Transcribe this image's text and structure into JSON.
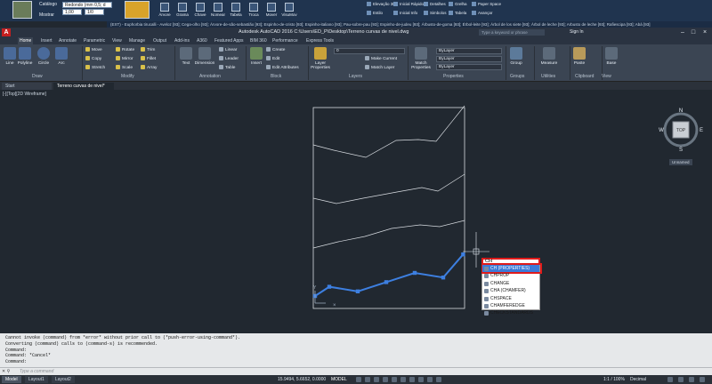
{
  "plugin_bar": {
    "catalog_label": "Catálogo",
    "tree_label": "Mostrar",
    "dropdown1": "Redondo (mm 0,5; d",
    "dropdown2": "1,00",
    "dropdown3": "1/0",
    "buttons": [
      "Árvore",
      "Grama",
      "Chave",
      "Nomear",
      "Tabela",
      "Troca",
      "Mover",
      "VisuMov"
    ],
    "small_col1": [
      "Elevação 3D",
      "Estilo",
      "Estilo"
    ],
    "small_col2": [
      "Inicial Rápido",
      "Inicial Info",
      "Inicial Info"
    ],
    "small_col3": [
      "Detalhes",
      "Simbolos",
      "Simbolos"
    ],
    "small_col4": [
      "Grelha",
      "Tabela",
      "Tabela"
    ],
    "small_col5": [
      "Paper Space",
      "Avançar",
      "Avançar"
    ]
  },
  "tip_strip": "(EXT) - Euphorbia tirucalli - Aveloz [93]; Cega-olho [93]; Árvore-de-são-sebastião [93]; Espinho-de-cristo [93]; Espinho-italiano [93]; Pau-sobre-pau [93]; Espinho-de-judeu [93]; Árbusto-de-goma [93]; Érbol-leite [93]; Árbol de los siete [93]; Árbol de leche [93]; Arbusto de leche [93]; Rafiescipa [93]; Abá [93]",
  "title_bar": {
    "title": "Autodesk AutoCAD 2016    C:\\Users\\ED_P\\Desktop\\Terreno curvas de nivel.dwg",
    "search_placeholder": "Type a keyword or phrase",
    "signin": "Sign In",
    "logo": "A"
  },
  "ribbon_tabs": [
    "Home",
    "Insert",
    "Annotate",
    "Parametric",
    "View",
    "Manage",
    "Output",
    "Add-ins",
    "A360",
    "Featured Apps",
    "BIM 360",
    "Performance",
    "Express Tools"
  ],
  "ribbon": {
    "draw_big": [
      "Line",
      "Polyline",
      "Circle",
      "Arc"
    ],
    "modify_small": [
      "Move",
      "Rotate",
      "Trim",
      "Copy",
      "Mirror",
      "Fillet",
      "Stretch",
      "Scale",
      "Array"
    ],
    "annotation": {
      "text": "Text",
      "dimension": "Dimension",
      "linear": "Linear",
      "leader": "Leader",
      "table": "Table"
    },
    "block": {
      "insert": "Insert",
      "create": "Create",
      "edit": "Edit",
      "edit_attributes": "Edit Attributes"
    },
    "layers": {
      "layer_properties": "Layer Properties",
      "layer_value": "0",
      "make_current": "Make Current",
      "match_layer": "Match Layer"
    },
    "properties": {
      "match": "Match Properties",
      "bylayer1": "ByLayer",
      "bylayer2": "ByLayer",
      "bylayer3": "ByLayer"
    },
    "groups": {
      "group": "Group"
    },
    "utilities": {
      "measure": "Measure"
    },
    "clipboard": {
      "paste": "Paste"
    },
    "view": {
      "base": "Base"
    },
    "panel_titles": [
      "Draw",
      "Modify",
      "Annotation",
      "Block",
      "Layers",
      "Properties",
      "Groups",
      "Utilities",
      "Clipboard",
      "View"
    ]
  },
  "doc_tabs": [
    "Start",
    "Terreno curvas de nivel*"
  ],
  "viewport_label": "[-][Top][2D Wireframe]",
  "viewcube": {
    "top": "TOP",
    "n": "N",
    "s": "S",
    "e": "E",
    "w": "W",
    "wcs": "Unnamed"
  },
  "chart_data": {
    "type": "line",
    "note_colors": {
      "contour": "#d9dde2",
      "polyline": "#3d7fe0",
      "grip": "#3d7fe0"
    },
    "series": [
      {
        "values": [
          [
            0,
            0
          ],
          [
            10,
            2
          ],
          [
            30,
            1
          ],
          [
            50,
            3
          ],
          [
            70,
            5
          ],
          [
            90,
            4
          ],
          [
            104,
            9
          ]
        ]
      }
    ]
  },
  "autocomplete": {
    "input_value": "CH",
    "items": [
      "CH (PROPERTIES)",
      "CHPROP",
      "CHANGE",
      "CHA (CHAMFER)",
      "CHSPACE",
      "CHAMFEREDGE",
      "CHECKSTANDARDS"
    ],
    "selected_index": 0
  },
  "command_history": [
    "Cannot invoke (command) from *error* without prior call to (*push-error-using-command*).",
    "Converting (command) calls to (command-s) is recommended.",
    "Command:",
    "Command: *Cancel*",
    "Command:"
  ],
  "command_line": {
    "placeholder": "Type a command",
    "icons": "✕ ⚲"
  },
  "status_bar": {
    "tabs": [
      "Model",
      "Layout1",
      "Layout2"
    ],
    "coords": "15.9494, 5.6652, 0.0000",
    "model": "MODEL",
    "scale": "1:1 / 100%",
    "units": "Decimal"
  }
}
